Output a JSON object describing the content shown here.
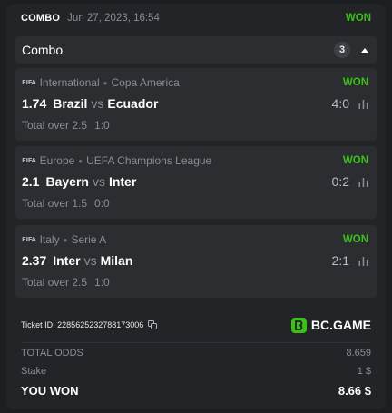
{
  "header": {
    "tag": "COMBO",
    "date": "Jun 27, 2023, 16:54",
    "status": "WON"
  },
  "combo": {
    "title": "Combo",
    "count": "3"
  },
  "matches": [
    {
      "region": "International",
      "league": "Copa America",
      "status": "WON",
      "odds": "1.74",
      "home": "Brazil",
      "vs": "vs",
      "away": "Ecuador",
      "score": "4:0",
      "market": "Total over 2.5",
      "result": "1:0"
    },
    {
      "region": "Europe",
      "league": "UEFA Champions League",
      "status": "WON",
      "odds": "2.1",
      "home": "Bayern",
      "vs": "vs",
      "away": "Inter",
      "score": "0:2",
      "market": "Total over 1.5",
      "result": "0:0"
    },
    {
      "region": "Italy",
      "league": "Serie A",
      "status": "WON",
      "odds": "2.37",
      "home": "Inter",
      "vs": "vs",
      "away": "Milan",
      "score": "2:1",
      "market": "Total over 2.5",
      "result": "1:0"
    }
  ],
  "ticket": {
    "id": "Ticket ID: 2285625232788173006",
    "brand": "BC.GAME",
    "logo_text": "FIFA"
  },
  "summary": {
    "total_odds_label": "TOTAL ODDS",
    "total_odds_value": "8.659",
    "stake_label": "Stake",
    "stake_value": "1 $",
    "won_label": "YOU WON",
    "won_value": "8.66 $"
  },
  "colors": {
    "background": "#1c1e22",
    "card": "#222428",
    "panel": "#2b2d31",
    "win_green": "#3bc117",
    "muted": "#8a8d93"
  }
}
